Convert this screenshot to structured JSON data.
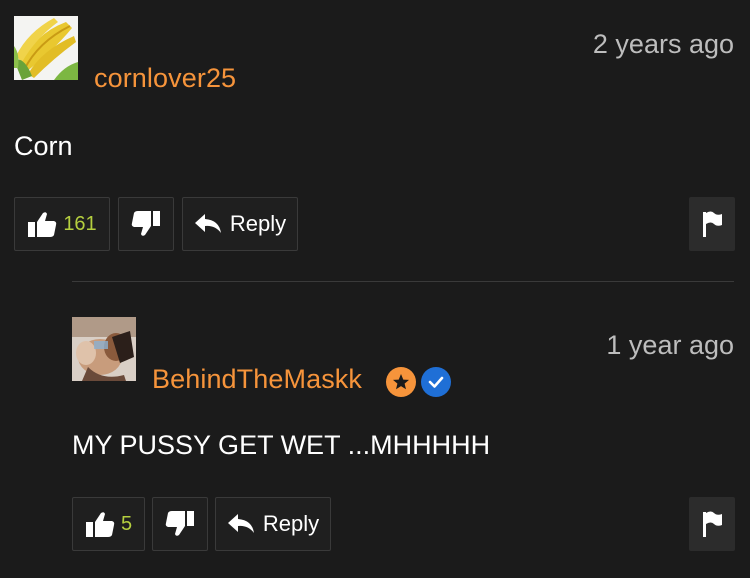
{
  "comments": [
    {
      "username": "cornlover25",
      "timestamp": "2 years ago",
      "text": "Corn",
      "likes": "161",
      "reply_label": "Reply",
      "avatar_icon": "corn-image"
    },
    {
      "username": "BehindTheMaskk",
      "timestamp": "1 year ago",
      "text": "MY PUSSY GET WET ...MHHHHH",
      "likes": "5",
      "reply_label": "Reply",
      "avatar_icon": "user-photo",
      "badges": [
        "star-badge-icon",
        "verified-badge-icon"
      ]
    }
  ],
  "colors": {
    "background": "#1b1b1b",
    "username": "#f6943b",
    "like_count": "#b5cf3f",
    "timestamp": "#bdbdbd",
    "star_badge": "#f6943b",
    "verified_badge": "#1f6fd6"
  }
}
